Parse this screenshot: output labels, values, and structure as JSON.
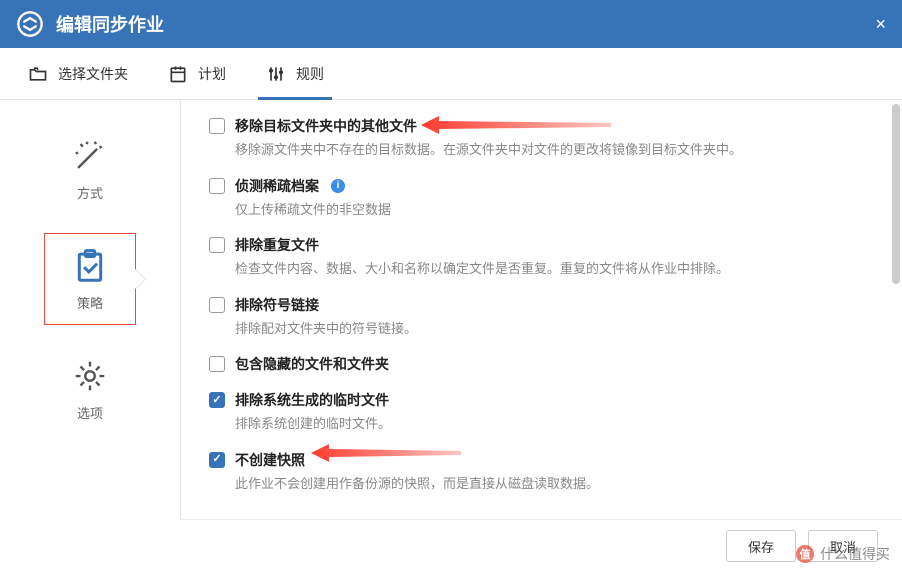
{
  "window": {
    "title": "编辑同步作业",
    "close": "×"
  },
  "tabs": [
    {
      "id": "folder",
      "label": "选择文件夹"
    },
    {
      "id": "schedule",
      "label": "计划"
    },
    {
      "id": "rules",
      "label": "规则"
    }
  ],
  "sidebar": [
    {
      "id": "mode",
      "label": "方式"
    },
    {
      "id": "strategy",
      "label": "策略"
    },
    {
      "id": "options",
      "label": "选项"
    }
  ],
  "options": [
    {
      "id": "remove_other",
      "checked": false,
      "label": "移除目标文件夹中的其他文件",
      "desc": "移除源文件夹中不存在的目标数据。在源文件夹中对文件的更改将镜像到目标文件夹中。"
    },
    {
      "id": "sparse",
      "checked": false,
      "label": "侦测稀疏档案",
      "desc": "仅上传稀疏文件的非空数据",
      "info": true
    },
    {
      "id": "dedup",
      "checked": false,
      "label": "排除重复文件",
      "desc": "检查文件内容、数据、大小和名称以确定文件是否重复。重复的文件将从作业中排除。"
    },
    {
      "id": "symlink",
      "checked": false,
      "label": "排除符号链接",
      "desc": "排除配对文件夹中的符号链接。"
    },
    {
      "id": "hidden",
      "checked": false,
      "label": "包含隐藏的文件和文件夹",
      "desc": ""
    },
    {
      "id": "tempfiles",
      "checked": true,
      "label": "排除系统生成的临时文件",
      "desc": "排除系统创建的临时文件。"
    },
    {
      "id": "nosnapshot",
      "checked": true,
      "label": "不创建快照",
      "desc": "此作业不会创建用作备份源的快照，而是直接从磁盘读取数据。"
    }
  ],
  "footer": {
    "save": "保存",
    "cancel": "取消"
  },
  "watermark": "什么值得买"
}
